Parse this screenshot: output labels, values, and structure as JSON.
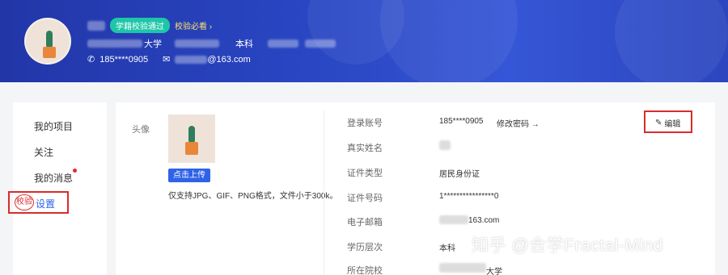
{
  "header": {
    "badge_label": "学籍校验通过",
    "verify_link": "校验必看",
    "school_suffix": "大学",
    "degree": "本科",
    "phone": "185****0905",
    "email_suffix": "@163.com"
  },
  "sidebar": {
    "items": [
      {
        "label": "我的项目"
      },
      {
        "label": "关注"
      },
      {
        "label": "我的消息"
      },
      {
        "label": "设置"
      }
    ],
    "verify_tag": "校验"
  },
  "profile": {
    "avatar_label": "头像",
    "upload_button": "点击上传",
    "upload_hint": "仅支持JPG、GIF、PNG格式，文件小于300k。",
    "edit_button": "编辑",
    "change_password": "修改密码",
    "fields": [
      {
        "label": "登录账号",
        "value": "185****0905"
      },
      {
        "label": "真实姓名",
        "value": ""
      },
      {
        "label": "证件类型",
        "value": "居民身份证"
      },
      {
        "label": "证件号码",
        "value": "1****************0"
      },
      {
        "label": "电子邮箱",
        "value": "163.com"
      },
      {
        "label": "学历层次",
        "value": "本科"
      },
      {
        "label": "所在院校",
        "value": "大学"
      }
    ]
  },
  "watermark": "知乎 @合学Fractal-Mind",
  "colors": {
    "banner": "#2a47c4",
    "accent": "#2f62e8",
    "badge": "#1ec6a8",
    "highlight": "#d92b2b"
  }
}
